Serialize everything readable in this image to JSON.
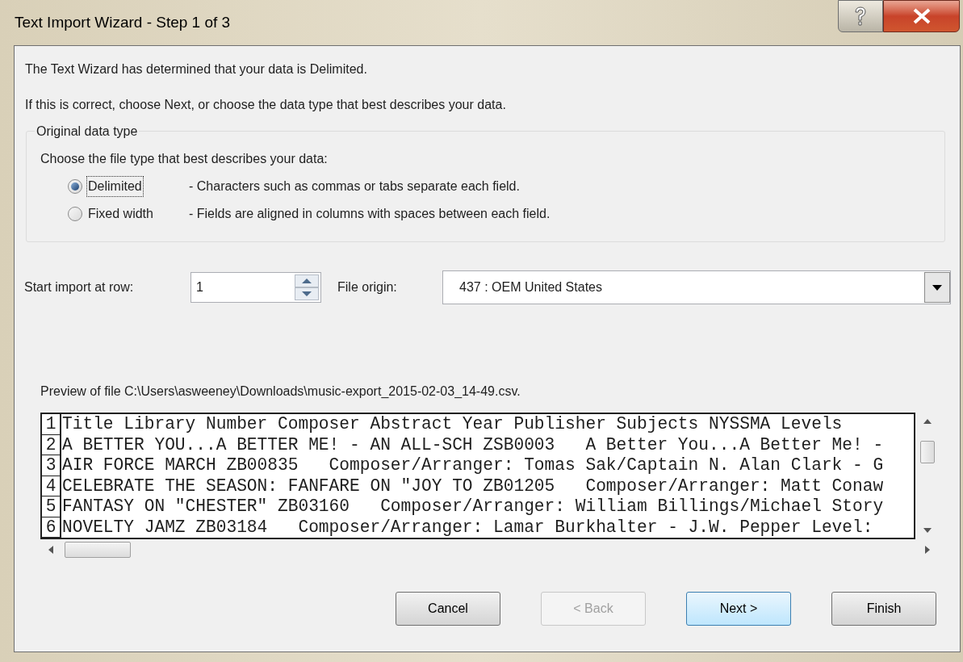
{
  "window": {
    "title": "Text Import Wizard - Step 1 of 3"
  },
  "intro": [
    "The Text Wizard has determined that your data is Delimited.",
    "If this is correct, choose Next, or choose the data type that best describes your data."
  ],
  "group": {
    "title": "Original data type",
    "prompt": "Choose the file type that best describes your data:",
    "options": [
      {
        "label": "Delimited",
        "description": "- Characters such as commas or tabs separate each field.",
        "selected": true
      },
      {
        "label": "Fixed width",
        "description": "- Fields are aligned in columns with spaces between each field.",
        "selected": false
      }
    ]
  },
  "start_row": {
    "label": "Start import at row:",
    "value": "1"
  },
  "file_origin": {
    "label": "File origin:",
    "value": "437 : OEM United States"
  },
  "preview": {
    "label": "Preview of file C:\\Users\\asweeney\\Downloads\\music-export_2015-02-03_14-49.csv.",
    "rows": [
      {
        "number": "1",
        "text": "Title Library Number Composer Abstract Year Publisher Subjects NYSSMA Levels"
      },
      {
        "number": "2",
        "text": "A BETTER YOU...A BETTER ME! - AN ALL-SCH ZSB0003   A Better You...A Better Me! -"
      },
      {
        "number": "3",
        "text": "AIR FORCE MARCH ZB00835   Composer/Arranger: Tomas Sak/Captain N. Alan Clark - G"
      },
      {
        "number": "4",
        "text": "CELEBRATE THE SEASON: FANFARE ON \"JOY TO ZB01205   Composer/Arranger: Matt Conaw"
      },
      {
        "number": "5",
        "text": "FANTASY ON \"CHESTER\" ZB03160   Composer/Arranger: William Billings/Michael Story"
      },
      {
        "number": "6",
        "text": "NOVELTY JAMZ ZB03184   Composer/Arranger: Lamar Burkhalter - J.W. Pepper Level:"
      }
    ]
  },
  "buttons": [
    {
      "label": "Cancel",
      "disabled": false,
      "default": false
    },
    {
      "label": "< Back",
      "disabled": true,
      "default": false
    },
    {
      "label": "Next >",
      "disabled": false,
      "default": true
    },
    {
      "label": "Finish",
      "disabled": false,
      "default": false
    }
  ]
}
